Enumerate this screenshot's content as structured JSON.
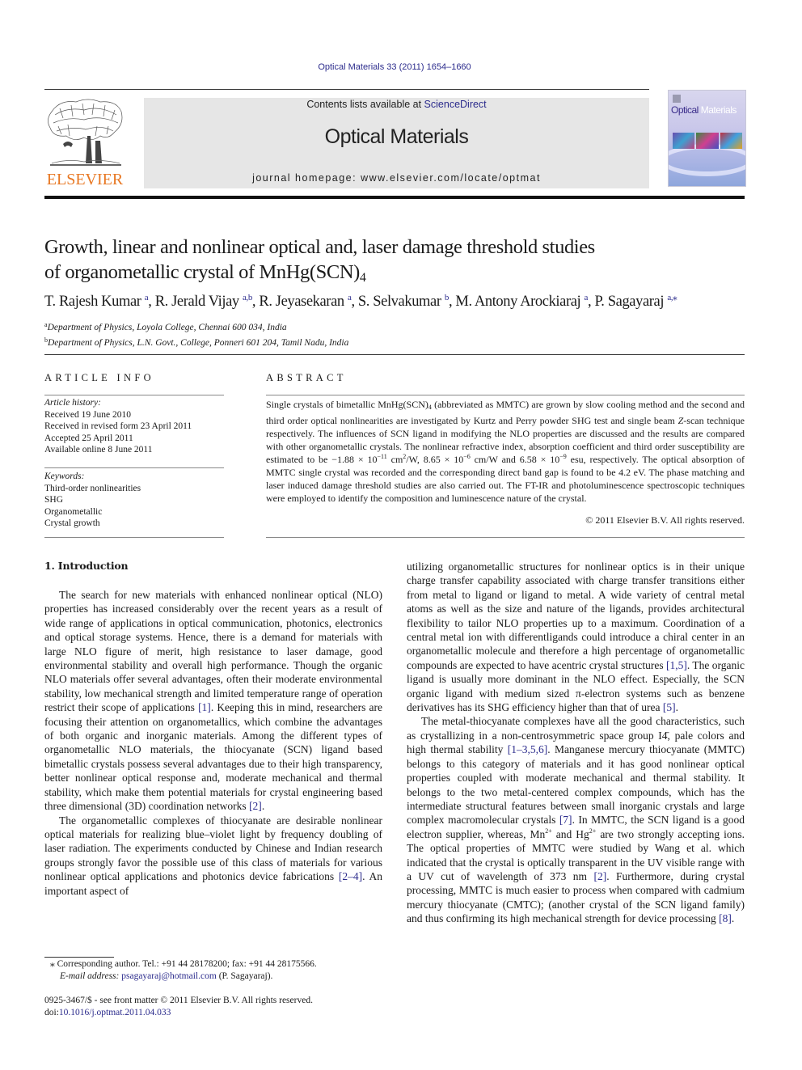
{
  "header": {
    "journal_ref": "Optical Materials 33 (2011) 1654–1660",
    "contents_prefix": "Contents lists available at ",
    "contents_link": "ScienceDirect",
    "journal_title": "Optical Materials",
    "homepage": "journal homepage: www.elsevier.com/locate/optmat",
    "publisher_logo_text": "ELSEVIER",
    "cover_title_part1": "Optical",
    "cover_title_part2": "Materials",
    "colors": {
      "elsevier_orange": "#e87722",
      "link_blue": "#2b2b8c",
      "masthead_gray": "#e6e6e6"
    }
  },
  "article": {
    "title_line1": "Growth, linear and nonlinear optical and, laser damage threshold studies",
    "title_line2_main": "of organometallic crystal of MnHg(SCN)",
    "title_line2_sub": "4",
    "authors": [
      {
        "name": "T. Rajesh Kumar",
        "aff": "a"
      },
      {
        "name": "R. Jerald Vijay",
        "aff": "a,b"
      },
      {
        "name": "R. Jeyasekaran",
        "aff": "a"
      },
      {
        "name": "S. Selvakumar",
        "aff": "b"
      },
      {
        "name": "M. Antony Arockiaraj",
        "aff": "a"
      },
      {
        "name": "P. Sagayaraj",
        "aff": "a,⁎"
      }
    ],
    "affiliations": [
      {
        "key": "a",
        "text": "Department of Physics, Loyola College, Chennai 600 034, India"
      },
      {
        "key": "b",
        "text": "Department of Physics, L.N. Govt., College, Ponneri 601 204, Tamil Nadu, India"
      }
    ]
  },
  "article_info": {
    "label": "ARTICLE INFO",
    "history_head": "Article history:",
    "history": [
      "Received 19 June 2010",
      "Received in revised form 23 April 2011",
      "Accepted 25 April 2011",
      "Available online 8 June 2011"
    ],
    "keywords_head": "Keywords:",
    "keywords": [
      "Third-order nonlinearities",
      "SHG",
      "Organometallic",
      "Crystal growth"
    ]
  },
  "abstract": {
    "label": "ABSTRACT",
    "t1": "Single crystals of bimetallic MnHg(SCN)",
    "t1_sub": "4",
    "t2": " (abbreviated as MMTC) are grown by slow cooling method and the second and third order optical nonlinearities are investigated by Kurtz and Perry powder SHG test and single beam ",
    "t2_italic": "Z",
    "t3": "-scan technique respectively. The influences of SCN ligand in modifying the NLO properties are discussed and the results are compared with other organometallic crystals. The nonlinear refractive index, absorption coefficient and third order susceptibility are estimated to be −1.88 × 10",
    "sup1": "−11",
    "t4": " cm",
    "sup2": "2",
    "t5": "/W, 8.65 × 10",
    "sup3": "−6",
    "t6": " cm/W and 6.58 × 10",
    "sup4": "−9",
    "t7": " esu, respectively. The optical absorption of MMTC single crystal was recorded and the corresponding direct band gap is found to be 4.2 eV. The phase matching and laser induced damage threshold studies are also carried out. The FT-IR and photoluminescence spectroscopic techniques were employed to identify the composition and luminescence nature of the crystal.",
    "copyright": "© 2011 Elsevier B.V. All rights reserved."
  },
  "body": {
    "section_heading": "1. Introduction",
    "left_p1": {
      "a": "The search for new materials with enhanced nonlinear optical (NLO) properties has increased considerably over the recent years as a result of wide range of applications in optical communication, photonics, electronics and optical storage systems. Hence, there is a demand for materials with large NLO figure of merit, high resistance to laser damage, good environmental stability and over­all high performance. Though the organic NLO materials offer sev­eral advantages, often their moderate environmental stability, low mechanical strength and limited temperature range of operation restrict their scope of applications ",
      "ref1": "[1]",
      "b": ". Keeping this in mind, researchers are focusing their attention on organometallics, which combine the advantages of both organic and inorganic materials. Among the different types of organometallic NLO materials, the thiocyanate (SCN) ligand based bimetallic crystals possess several advantages due to their high transparency, better nonlinear optical response and, moderate mechanical and thermal stability, which make them potential materials for crystal engineering based three dimensional (3D) coordination networks ",
      "ref2": "[2]",
      "c": "."
    },
    "left_p2": {
      "a": "The organometallic complexes of thiocyanate are desirable non­linear optical materials for realizing blue–violet light by frequency doubling of laser radiation. The experiments conducted by Chinese and Indian research groups strongly favor the possible use of this class of materials for various nonlinear optical applications and photonics device fabrications ",
      "ref1": "[2–4]",
      "b": ". An important aspect of"
    },
    "right_p1": {
      "a": "utilizing organometallic structures for nonlinear optics is in their unique charge transfer capability associated with charge transfer transitions either from metal to ligand or ligand to metal. A wide variety of central metal atoms as well as the size and nature of the ligands, provides architectural flexibility to tailor NLO proper­ties up to a maximum. Coordination of a central metal ion with dif­ferentligands could introduce a chiral center in an organometallic molecule and therefore a high percentage of organometallic com­pounds are expected to have acentric crystal structures ",
      "ref1": "[1,5]",
      "b": ". The organic ligand is usually more dominant in the NLO effect. Espe­cially, the SCN organic ligand with medium sized π-electron sys­tems such as benzene derivatives has its SHG efficiency higher than that of urea ",
      "ref2": "[5]",
      "c": "."
    },
    "right_p2": {
      "a": "The metal-thiocyanate complexes have all the good characteris­tics, such as crystallizing in a non-centrosymmetric space group I4̄, pale colors and high thermal stability ",
      "ref1": "[1–3,5,6]",
      "b": ". Manganese mer­cury thiocyanate (MMTC) belongs to this category of materials and it has good nonlinear optical properties coupled with moder­ate mechanical and thermal stability. It belongs to the two me­tal-centered complex compounds, which has the intermediate structural features between small inorganic crystals and large complex macromolecular crystals ",
      "ref2": "[7]",
      "c": ". In MMTC, the SCN ligand is a good electron supplier, whereas, Mn",
      "sup1": "2+",
      "d": " and Hg",
      "sup2": "2+",
      "e": " are two strongly accepting ions. The optical properties of MMTC were studied by Wang et al. which indicated that the crystal is optically transparent in the UV visible range with a UV cut of wavelength of 373 nm ",
      "ref3": "[2]",
      "f": ". Furthermore, during crystal processing, MMTC is much easier to process when compared with cadmium mercury thiocyanate (CMTC); (another crystal of the SCN ligand family) and thus con­firming its high mechanical strength for device processing ",
      "ref4": "[8]",
      "g": "."
    }
  },
  "footnote": {
    "marker": "⁎",
    "corresponding": " Corresponding author. Tel.: +91 44 28178200; fax: +91 44 28175566.",
    "email_label": "E-mail address:",
    "email": "psagayaraj@hotmail.com",
    "email_suffix": " (P. Sagayaraj)."
  },
  "footer": {
    "issn_line": "0925-3467/$ - see front matter © 2011 Elsevier B.V. All rights reserved.",
    "doi_prefix": "doi:",
    "doi": "10.1016/j.optmat.2011.04.033"
  }
}
